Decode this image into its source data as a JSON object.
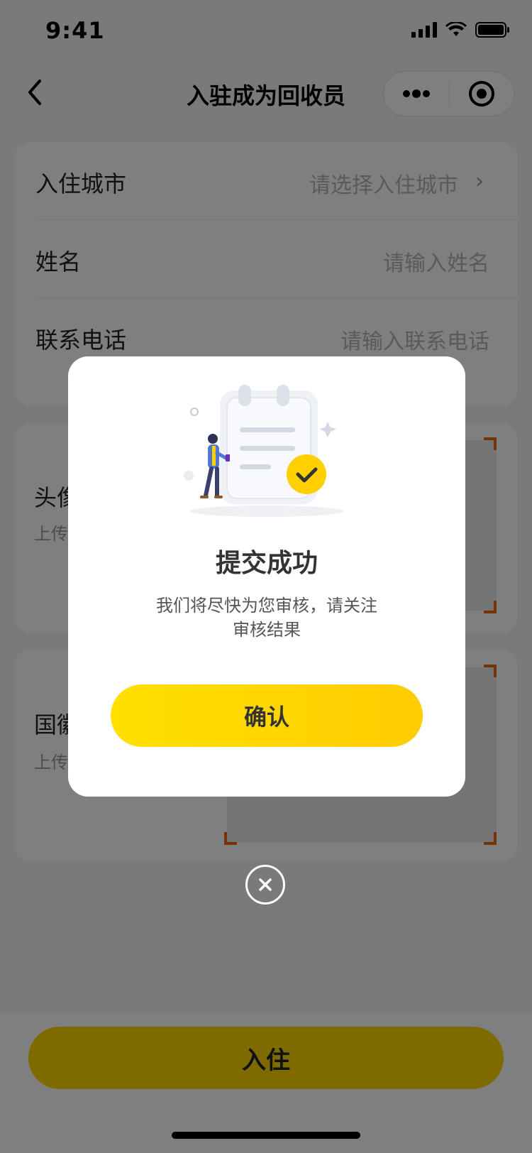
{
  "status_bar": {
    "time": "9:41"
  },
  "nav": {
    "title": "入驻成为回收员"
  },
  "form": {
    "city": {
      "label": "入住城市",
      "placeholder": "请选择入住城市"
    },
    "name": {
      "label": "姓名",
      "placeholder": "请输入姓名"
    },
    "phone": {
      "label": "联系电话",
      "placeholder": "请输入联系电话"
    }
  },
  "uploads": [
    {
      "label": "头像",
      "sub": "上传"
    },
    {
      "label": "国徽",
      "sub": "上传"
    }
  ],
  "bottom": {
    "submit_label": "入住"
  },
  "modal": {
    "title": "提交成功",
    "desc_line1": "我们将尽快为您审核，请关注",
    "desc_line2": "审核结果",
    "confirm_label": "确认"
  },
  "colors": {
    "accent": "#ffd400",
    "corner": "#e8650f",
    "overlay": "rgba(0,0,0,0.5)"
  }
}
